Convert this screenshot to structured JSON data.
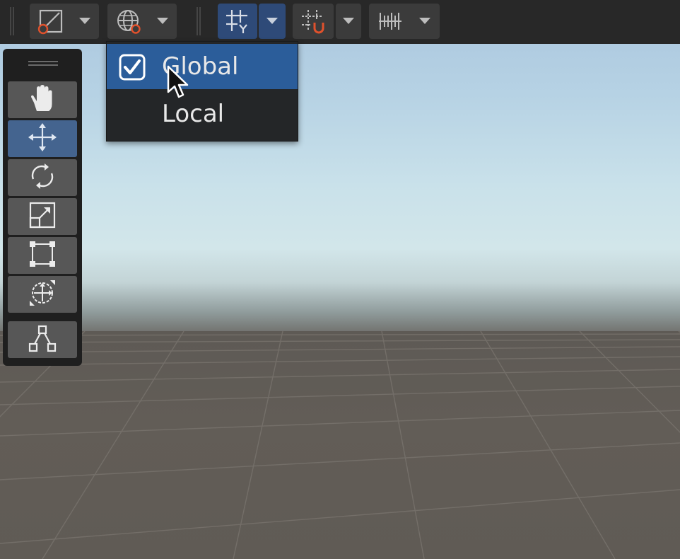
{
  "toolbar": {
    "buttons": [
      {
        "icon": "view-options-icon",
        "has_dropdown": true,
        "active": false
      },
      {
        "icon": "global-orientation-icon",
        "has_dropdown": true,
        "active": false
      },
      {
        "icon": "grid-snap-icon",
        "has_dropdown": true,
        "active": true
      },
      {
        "icon": "increment-snap-icon",
        "has_dropdown": true,
        "active": false
      },
      {
        "icon": "snap-ruler-icon",
        "has_dropdown": true,
        "active": false
      }
    ]
  },
  "tools_panel": {
    "tools": [
      {
        "icon": "hand-icon",
        "active": false
      },
      {
        "icon": "move-icon",
        "active": true
      },
      {
        "icon": "rotate-icon",
        "active": false
      },
      {
        "icon": "scale-icon",
        "active": false
      },
      {
        "icon": "rect-tool-icon",
        "active": false
      },
      {
        "icon": "transform-icon",
        "active": false
      },
      {
        "icon": "custom-tool-icon",
        "active": false
      }
    ]
  },
  "orientation_menu": {
    "items": [
      {
        "label": "Global",
        "checked": true,
        "highlighted": true
      },
      {
        "label": "Local",
        "checked": false,
        "highlighted": false
      }
    ]
  },
  "colors": {
    "toolbar_bg": "#282828",
    "active_blue": "#2e4a78",
    "menu_highlight": "#2b5d9a",
    "accent_orange": "#e0512c",
    "sky_top": "#aac6de",
    "ground": "#605b55"
  }
}
